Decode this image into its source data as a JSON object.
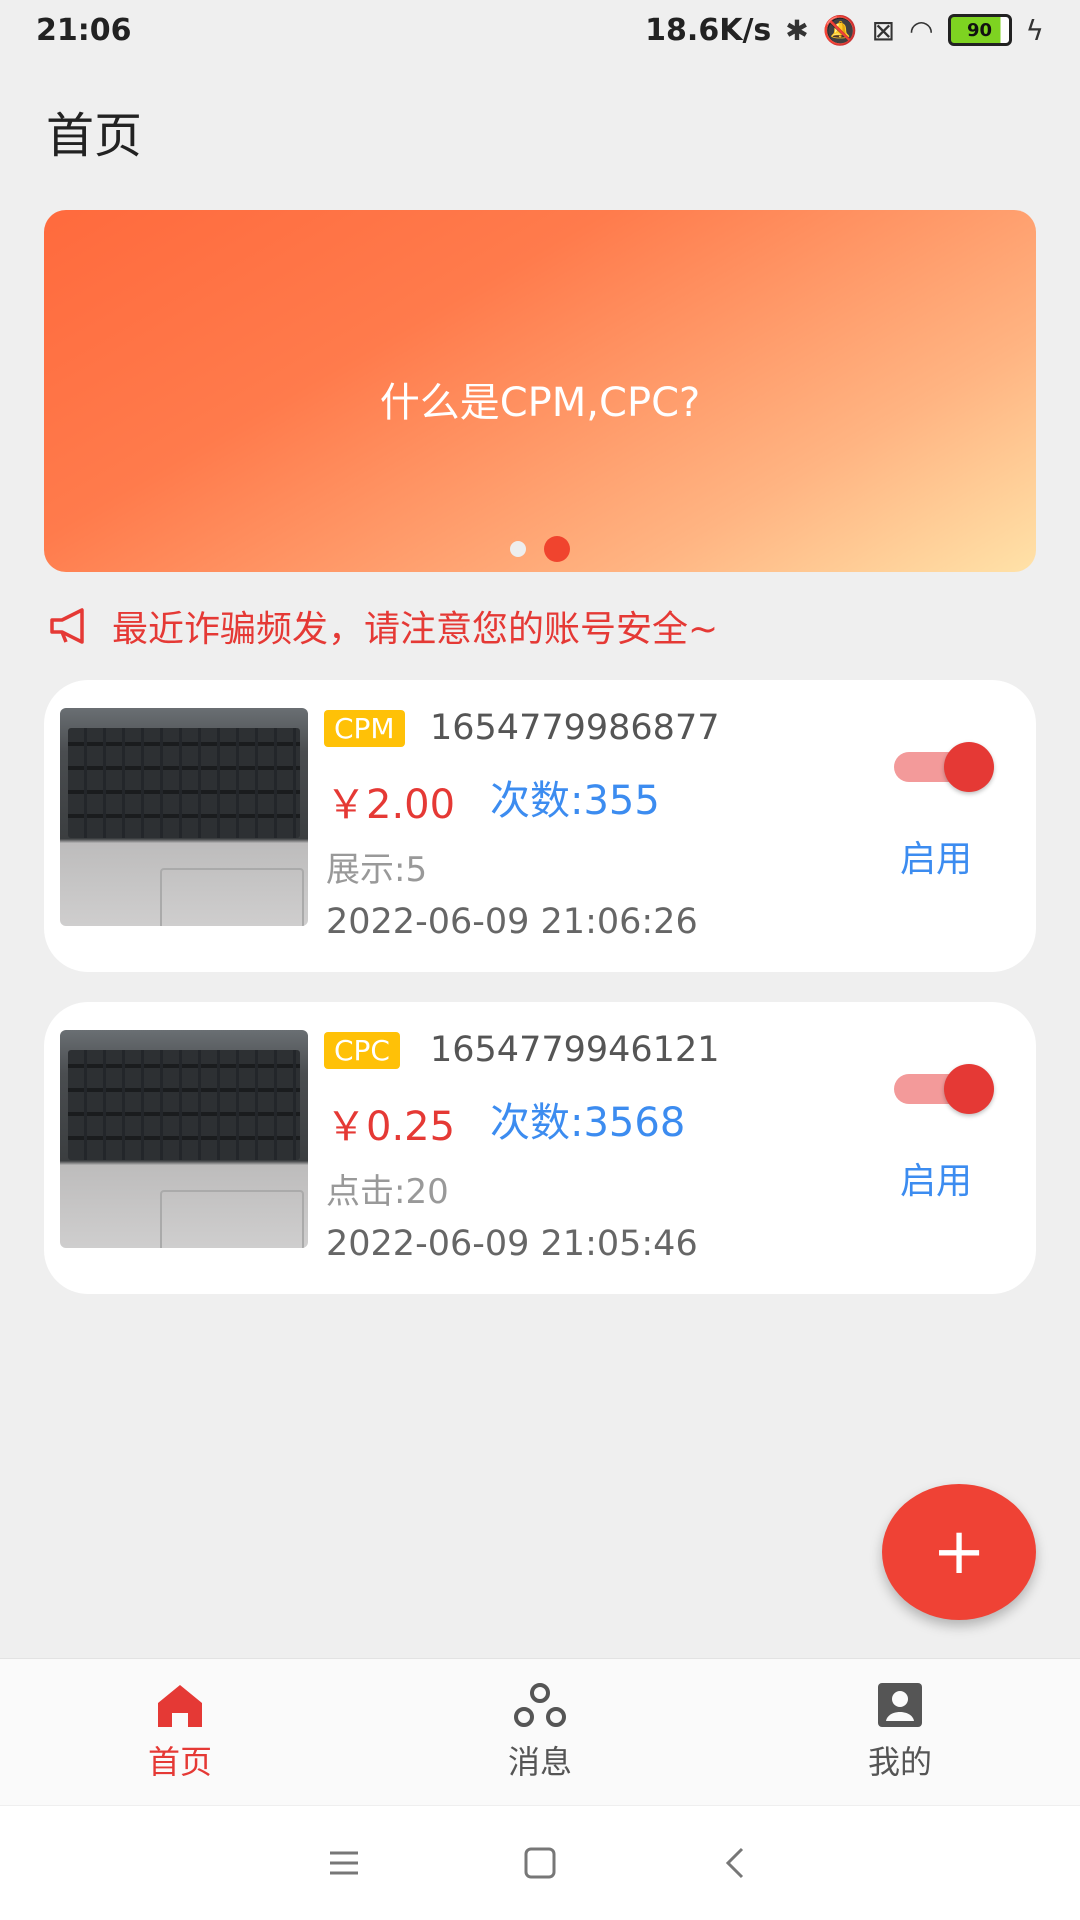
{
  "status_bar": {
    "time": "21:06",
    "net_speed": "18.6K/s",
    "battery": "90",
    "icons": [
      "bluetooth-icon",
      "mute-icon",
      "sim-icon",
      "wifi-icon",
      "battery-icon",
      "charging-icon"
    ]
  },
  "page": {
    "title": "首页"
  },
  "banner": {
    "text": "什么是CPM,CPC?",
    "dots": 2,
    "active_dot": 1
  },
  "notice": {
    "text": "最近诈骗频发，请注意您的账号安全~",
    "icon": "megaphone-icon"
  },
  "cards": [
    {
      "tag": "CPM",
      "id": "1654779986877",
      "price": "￥2.00",
      "count": "次数:355",
      "stat": "展示:5",
      "date": "2022-06-09 21:06:26",
      "toggle_on": true,
      "status": "启用"
    },
    {
      "tag": "CPC",
      "id": "1654779946121",
      "price": "￥0.25",
      "count": "次数:3568",
      "stat": "点击:20",
      "date": "2022-06-09 21:05:46",
      "toggle_on": true,
      "status": "启用"
    }
  ],
  "fab": {
    "label": "+"
  },
  "bottom_nav": [
    {
      "label": "首页",
      "icon": "home-icon",
      "active": true
    },
    {
      "label": "消息",
      "icon": "message-icon",
      "active": false
    },
    {
      "label": "我的",
      "icon": "profile-icon",
      "active": false
    }
  ],
  "colors": {
    "accent": "#e53935",
    "blue": "#3c8cf0",
    "tag": "#ffc107"
  }
}
